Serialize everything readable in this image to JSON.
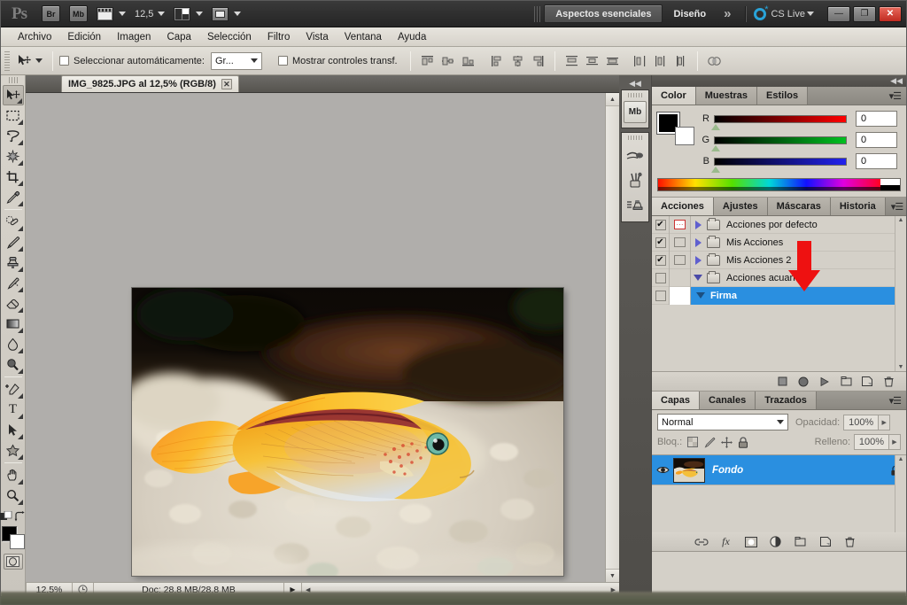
{
  "app": {
    "name": "Adobe Photoshop CS5",
    "logo_text": "Ps"
  },
  "titlebar": {
    "bridge_label": "Br",
    "minibridge_label": "Mb",
    "screen_mode_icon": "screen-mode-icon",
    "zoom_value": "12,5",
    "arrange_icon": "arrange-documents-icon",
    "screenmode_icon": "screen-mode-selector-icon",
    "workspaces": [
      {
        "label": "Aspectos esenciales",
        "active": true
      },
      {
        "label": "Diseño",
        "active": false
      }
    ],
    "more_workspaces": "»",
    "cslive_label": "CS Live",
    "window_buttons": {
      "minimize": "—",
      "maximize": "❐",
      "close": "✕"
    }
  },
  "menubar": {
    "items": [
      "Archivo",
      "Edición",
      "Imagen",
      "Capa",
      "Selección",
      "Filtro",
      "Vista",
      "Ventana",
      "Ayuda"
    ]
  },
  "optionsbar": {
    "tool_icon": "move-tool-icon",
    "auto_select_label": "Seleccionar automáticamente:",
    "auto_select_checked": false,
    "auto_select_value": "Gr...",
    "show_transform_label": "Mostrar controles transf.",
    "show_transform_checked": false,
    "align_icons": [
      "align-left-edges-icon",
      "align-horizontal-centers-icon",
      "align-right-edges-icon",
      "align-top-edges-icon",
      "align-vertical-centers-icon",
      "align-bottom-edges-icon"
    ],
    "distribute_icons": [
      "distribute-top-edges-icon",
      "distribute-vertical-centers-icon",
      "distribute-bottom-edges-icon",
      "distribute-left-edges-icon",
      "distribute-horizontal-centers-icon",
      "distribute-right-edges-icon"
    ],
    "auto_align_icon": "auto-align-layers-icon"
  },
  "toolbar": {
    "tools": [
      {
        "name": "move-tool",
        "glyph": "➤",
        "active": true
      },
      {
        "name": "rectangular-marquee-tool",
        "glyph": "▭",
        "active": false
      },
      {
        "name": "lasso-tool",
        "glyph": "⊿",
        "active": false
      },
      {
        "name": "magic-wand-tool",
        "glyph": "✳",
        "active": false
      },
      {
        "name": "crop-tool",
        "glyph": "⌗",
        "active": false
      },
      {
        "name": "eyedropper-tool",
        "glyph": "✎",
        "active": false
      },
      {
        "name": "spot-healing-brush-tool",
        "glyph": "◍",
        "active": false
      },
      {
        "name": "brush-tool",
        "glyph": "✒",
        "active": false
      },
      {
        "name": "clone-stamp-tool",
        "glyph": "⊥",
        "active": false
      },
      {
        "name": "history-brush-tool",
        "glyph": "❧",
        "active": false
      },
      {
        "name": "eraser-tool",
        "glyph": "▰",
        "active": false
      },
      {
        "name": "gradient-tool",
        "glyph": "◣",
        "active": false
      },
      {
        "name": "blur-tool",
        "glyph": "💧",
        "active": false
      },
      {
        "name": "dodge-tool",
        "glyph": "🔍",
        "active": false
      },
      {
        "name": "pen-tool",
        "glyph": "✑",
        "active": false
      },
      {
        "name": "type-tool",
        "glyph": "T",
        "active": false
      },
      {
        "name": "path-selection-tool",
        "glyph": "➚",
        "active": false
      },
      {
        "name": "custom-shape-tool",
        "glyph": "✦",
        "active": false
      },
      {
        "name": "hand-tool",
        "glyph": "✋",
        "active": false
      },
      {
        "name": "zoom-tool",
        "glyph": "🔎",
        "active": false
      }
    ],
    "foreground_color": "#000000",
    "background_color": "#ffffff",
    "quickmask_icon": "quick-mask-mode-icon"
  },
  "document": {
    "tab_title": "IMG_9825.JPG al 12,5% (RGB/8)",
    "close_glyph": "✕"
  },
  "statusbar": {
    "zoom": "12,5%",
    "clock_icon": "document-info-icon",
    "doc_info": "Doc: 28,8 MB/28,8 MB",
    "expand_glyph": "▶"
  },
  "iconrail": {
    "collapse_glyph": "◀◀",
    "buttons": [
      {
        "name": "mini-bridge-panel-icon",
        "label": "Mb"
      },
      {
        "name": "brush-presets-panel-icon",
        "label": ""
      },
      {
        "name": "brush-panel-icon",
        "label": ""
      },
      {
        "name": "clone-source-panel-icon",
        "label": ""
      }
    ]
  },
  "color_panel": {
    "tabs": [
      {
        "label": "Color",
        "active": true
      },
      {
        "label": "Muestras",
        "active": false
      },
      {
        "label": "Estilos",
        "active": false
      }
    ],
    "menu_glyph": "▾☰",
    "channels": [
      {
        "letter": "R",
        "value": "0",
        "gradient_from": "#000000",
        "gradient_to": "#ff0000"
      },
      {
        "letter": "G",
        "value": "0",
        "gradient_from": "#000000",
        "gradient_to": "#00cc22"
      },
      {
        "letter": "B",
        "value": "0",
        "gradient_from": "#000000",
        "gradient_to": "#3333ff"
      }
    ],
    "foreground": "#000000",
    "background": "#ffffff"
  },
  "actions_panel": {
    "tabs": [
      {
        "label": "Acciones",
        "active": true
      },
      {
        "label": "Ajustes",
        "active": false
      },
      {
        "label": "Máscaras",
        "active": false
      },
      {
        "label": "Historia",
        "active": false
      }
    ],
    "menu_glyph": "▾☰",
    "rows": [
      {
        "name": "Acciones por defecto",
        "checked": true,
        "dialog": true,
        "expanded": false,
        "selected": false,
        "indent": 0
      },
      {
        "name": "Mis Acciones",
        "checked": true,
        "dialog": false,
        "expanded": false,
        "selected": false,
        "indent": 0
      },
      {
        "name": "Mis Acciones 2",
        "checked": true,
        "dialog": false,
        "expanded": false,
        "selected": false,
        "indent": 0
      },
      {
        "name": "Acciones acuario",
        "checked": false,
        "dialog": false,
        "expanded": true,
        "selected": false,
        "indent": 0
      },
      {
        "name": "Firma",
        "checked": false,
        "dialog": false,
        "expanded": true,
        "selected": true,
        "indent": 1
      }
    ],
    "annotation": {
      "type": "red-arrow",
      "points_to": "play-selection-button",
      "color": "#ee1111"
    },
    "buttons": [
      {
        "name": "stop-playing-button",
        "glyph": "■"
      },
      {
        "name": "begin-recording-button",
        "glyph": "●"
      },
      {
        "name": "play-selection-button",
        "glyph": "▶"
      },
      {
        "name": "create-new-set-button",
        "glyph": "▭"
      },
      {
        "name": "create-new-action-button",
        "glyph": "❐"
      },
      {
        "name": "delete-button",
        "glyph": "🗑"
      }
    ]
  },
  "layers_panel": {
    "tabs": [
      {
        "label": "Capas",
        "active": true
      },
      {
        "label": "Canales",
        "active": false
      },
      {
        "label": "Trazados",
        "active": false
      }
    ],
    "menu_glyph": "▾☰",
    "blend_mode": "Normal",
    "opacity_label": "Opacidad:",
    "opacity_value": "100%",
    "lock_label": "Bloq.:",
    "lock_icons": [
      "lock-transparent-pixels-icon",
      "lock-image-pixels-icon",
      "lock-position-icon",
      "lock-all-icon"
    ],
    "fill_label": "Relleno:",
    "fill_value": "100%",
    "layers": [
      {
        "name": "Fondo",
        "visible": true,
        "locked": true,
        "selected": true,
        "italic": true
      }
    ],
    "buttons": [
      {
        "name": "link-layers-button",
        "glyph": "🔗"
      },
      {
        "name": "layer-style-button",
        "glyph": "fx"
      },
      {
        "name": "add-layer-mask-button",
        "glyph": "◻"
      },
      {
        "name": "new-adjustment-layer-button",
        "glyph": "◐"
      },
      {
        "name": "new-group-button",
        "glyph": "▭"
      },
      {
        "name": "new-layer-button",
        "glyph": "❐"
      },
      {
        "name": "delete-layer-button",
        "glyph": "🗑"
      }
    ]
  },
  "image": {
    "subject": "orange cichlid aquarium fish over gravel",
    "canvas_bg": "#b0aeab"
  }
}
